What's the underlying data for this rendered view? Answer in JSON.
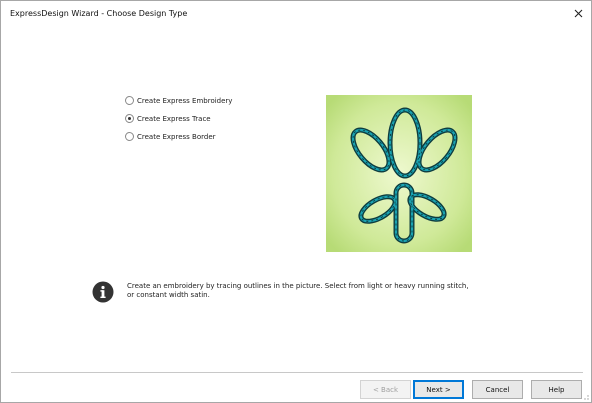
{
  "window": {
    "title": "ExpressDesign Wizard - Choose Design Type"
  },
  "options": [
    {
      "label": "Create Express Embroidery",
      "checked": false
    },
    {
      "label": "Create Express Trace",
      "checked": true
    },
    {
      "label": "Create Express Border",
      "checked": false
    }
  ],
  "preview": {
    "background_color": "#c9e78c",
    "outline_color": "#1a9aa8"
  },
  "info": {
    "text": "Create an embroidery by tracing outlines in the picture. Select from light or heavy running stitch, or constant width satin."
  },
  "buttons": {
    "back": "< Back",
    "next": "Next >",
    "cancel": "Cancel",
    "help": "Help"
  }
}
